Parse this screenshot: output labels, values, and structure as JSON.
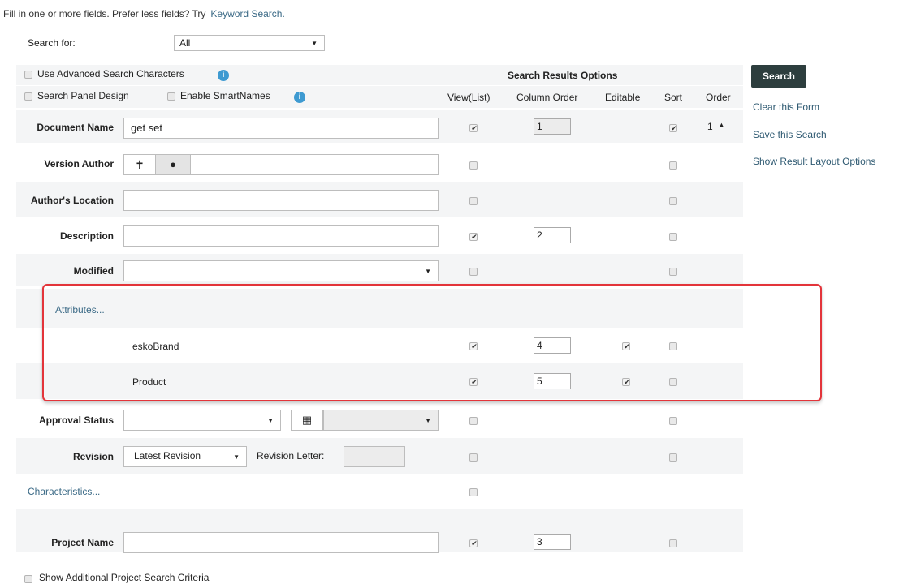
{
  "intro": {
    "text": "Fill in one or more fields. Prefer less fields? Try",
    "link": "Keyword Search."
  },
  "search_for": {
    "label": "Search for:",
    "value": "All"
  },
  "options": {
    "advanced": "Use Advanced Search Characters",
    "panel_design": "Search Panel Design",
    "smartnames": "Enable SmartNames",
    "info_icon": "i"
  },
  "results_header": {
    "title": "Search Results Options",
    "view_list": "View(List)",
    "column_order": "Column Order",
    "editable": "Editable",
    "sort": "Sort",
    "order": "Order"
  },
  "actions": {
    "search": "Search",
    "clear": "Clear this Form",
    "save": "Save this Search",
    "layout": "Show Result Layout Options"
  },
  "rows": {
    "document_name": {
      "label": "Document Name",
      "value": "get set",
      "column_order": "1",
      "order": "1"
    },
    "version_author": {
      "label": "Version Author"
    },
    "authors_location": {
      "label": "Author's Location"
    },
    "description": {
      "label": "Description",
      "column_order": "2"
    },
    "modified": {
      "label": "Modified"
    },
    "attributes": {
      "label": "Attributes..."
    },
    "esko_brand": {
      "label": "eskoBrand",
      "column_order": "4"
    },
    "product": {
      "label": "Product",
      "column_order": "5"
    },
    "approval_status": {
      "label": "Approval Status"
    },
    "revision": {
      "label": "Revision",
      "value": "Latest Revision",
      "letter_label": "Revision Letter:"
    },
    "characteristics": {
      "label": "Characteristics..."
    },
    "project_name": {
      "label": "Project Name",
      "column_order": "3"
    }
  },
  "footer": {
    "additional": "Show Additional Project Search Criteria"
  },
  "colors": {
    "accent_button": "#2d3e3e",
    "highlight_border": "#e3343a",
    "info": "#3e9ad1",
    "link": "#3b6a86"
  }
}
